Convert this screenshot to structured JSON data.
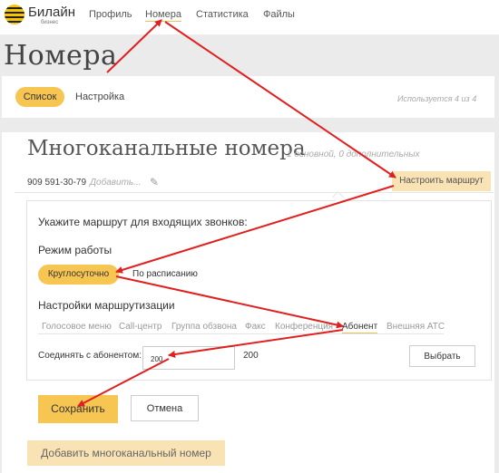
{
  "header": {
    "brand": "Билайн",
    "brand_sub": "бизнес",
    "nav": [
      "Профиль",
      "Номера",
      "Статистика",
      "Файлы"
    ],
    "active_nav": "Номера"
  },
  "page": {
    "title": "Номера"
  },
  "tabs": {
    "items": [
      "Список",
      "Настройка"
    ],
    "active": "Список",
    "usage": "Используется 4 из 4"
  },
  "section": {
    "title": "Многоканальные номера",
    "subtitle": "1 основной, 0 дополнительных",
    "phone": "909 591-30-79",
    "add_name": "Добавить...",
    "route_button": "Настроить маршрут"
  },
  "routing": {
    "prompt": "Укажите маршрут для входящих звонков:",
    "mode_label": "Режим работы",
    "modes": [
      "Круглосуточно",
      "По расписанию"
    ],
    "active_mode": "Круглосуточно",
    "settings_label": "Настройки маршрутизации",
    "route_tabs": [
      "Голосовое меню",
      "Call-центр",
      "Группа обзвона",
      "Факс",
      "Конференция",
      "Абонент",
      "Внешняя АТС"
    ],
    "active_route_tab": "Абонент",
    "connect_label": "Соединять с абонентом:",
    "input_value": "200",
    "selected_value": "200",
    "select_button": "Выбрать"
  },
  "actions": {
    "save": "Сохранить",
    "cancel": "Отмена",
    "add_number": "Добавить многоканальный номер"
  },
  "colors": {
    "accent": "#f7c652",
    "accent_light": "#f9e3b4",
    "arrow": "#e02020"
  }
}
